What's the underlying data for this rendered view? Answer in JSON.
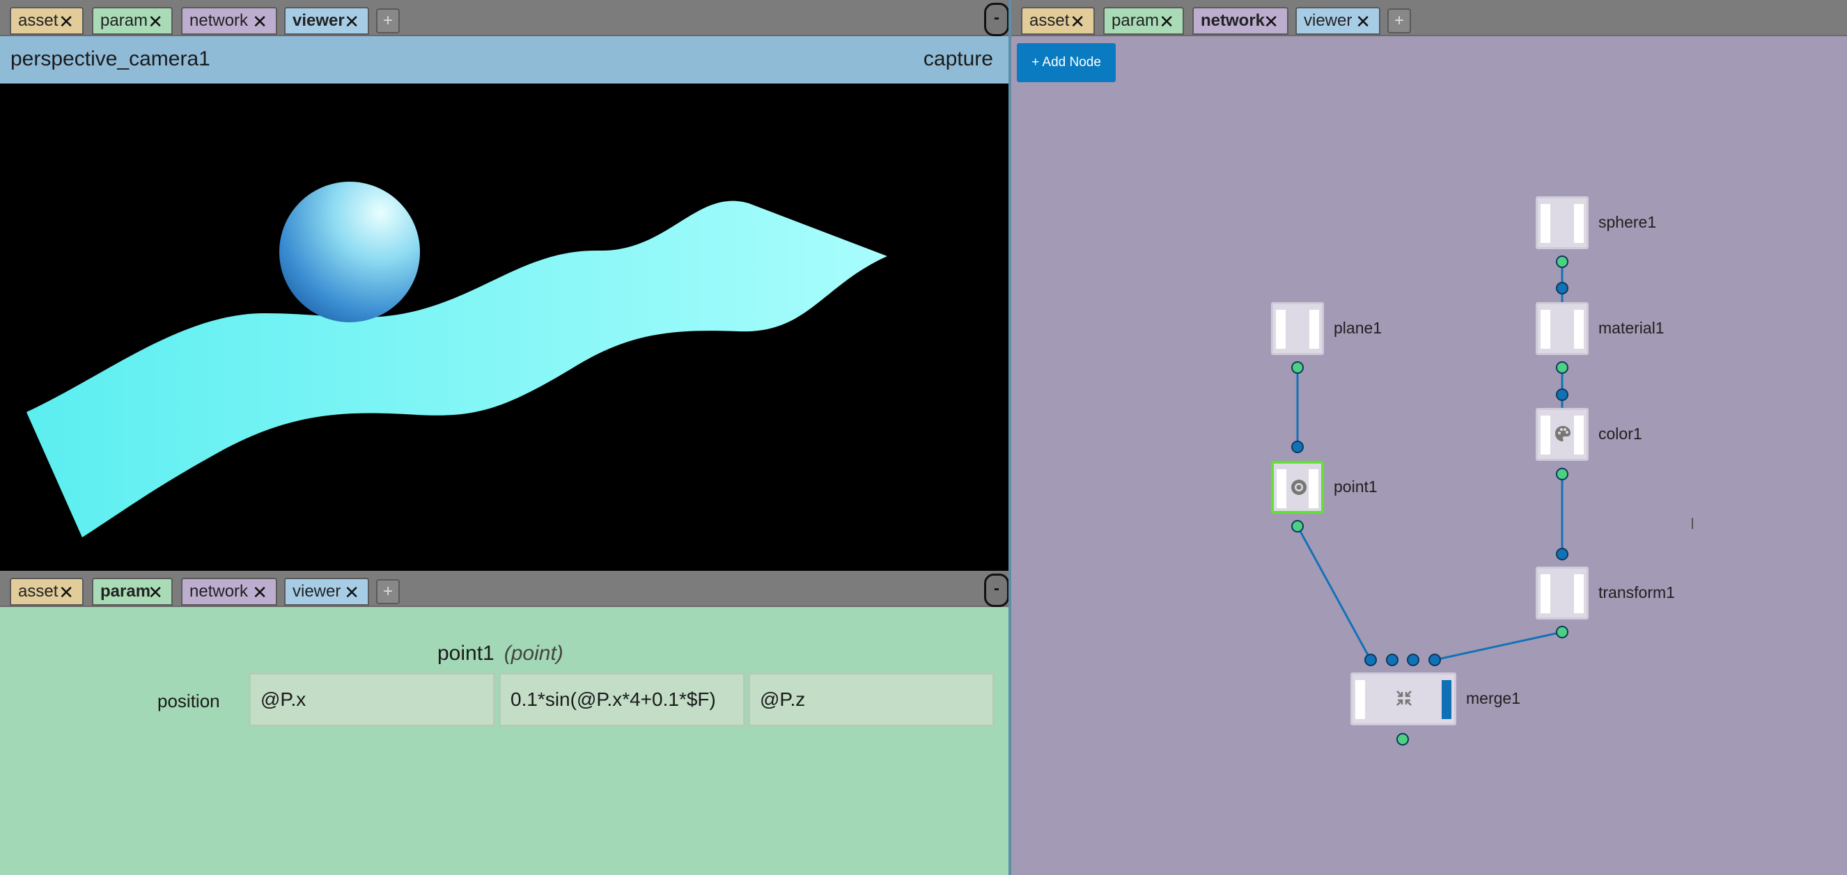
{
  "left_top_pane": {
    "tabs": [
      {
        "label": "asset",
        "color": "asset",
        "active": false
      },
      {
        "label": "param",
        "color": "param",
        "active": false
      },
      {
        "label": "network",
        "color": "network",
        "active": false
      },
      {
        "label": "viewer",
        "color": "viewer",
        "active": true
      }
    ],
    "plus_label": "+",
    "minus_label": "-",
    "camera_name": "perspective_camera1",
    "capture_label": "capture"
  },
  "left_bottom_pane": {
    "tabs": [
      {
        "label": "asset",
        "color": "asset",
        "active": false
      },
      {
        "label": "param",
        "color": "param",
        "active": true
      },
      {
        "label": "network",
        "color": "network",
        "active": false
      },
      {
        "label": "viewer",
        "color": "viewer",
        "active": false
      }
    ],
    "plus_label": "+",
    "minus_label": "-",
    "node_name": "point1",
    "node_type": "(point)",
    "param_label": "position",
    "fields": [
      "@P.x",
      "0.1*sin(@P.x*4+0.1*$F)",
      "@P.z"
    ]
  },
  "right_pane": {
    "tabs": [
      {
        "label": "asset",
        "color": "asset",
        "active": false
      },
      {
        "label": "param",
        "color": "param",
        "active": false
      },
      {
        "label": "network",
        "color": "network",
        "active": true
      },
      {
        "label": "viewer",
        "color": "viewer",
        "active": false
      }
    ],
    "plus_label": "+",
    "add_node_label": "+ Add Node",
    "nodes": [
      {
        "name": "sphere1",
        "icon": "none"
      },
      {
        "name": "plane1",
        "icon": "none"
      },
      {
        "name": "material1",
        "icon": "none"
      },
      {
        "name": "color1",
        "icon": "palette-icon"
      },
      {
        "name": "point1",
        "icon": "target-icon",
        "selected": true
      },
      {
        "name": "transform1",
        "icon": "none"
      },
      {
        "name": "merge1",
        "icon": "merge-arrows-icon"
      }
    ]
  },
  "colors": {
    "asset": "#e1cc9a",
    "param": "#a9dcb6",
    "network": "#bdaed0",
    "viewer": "#a7cde6",
    "connection": "#1272b8",
    "output_port": "#4ed083",
    "input_port": "#1272b8",
    "selection": "#62e038"
  }
}
